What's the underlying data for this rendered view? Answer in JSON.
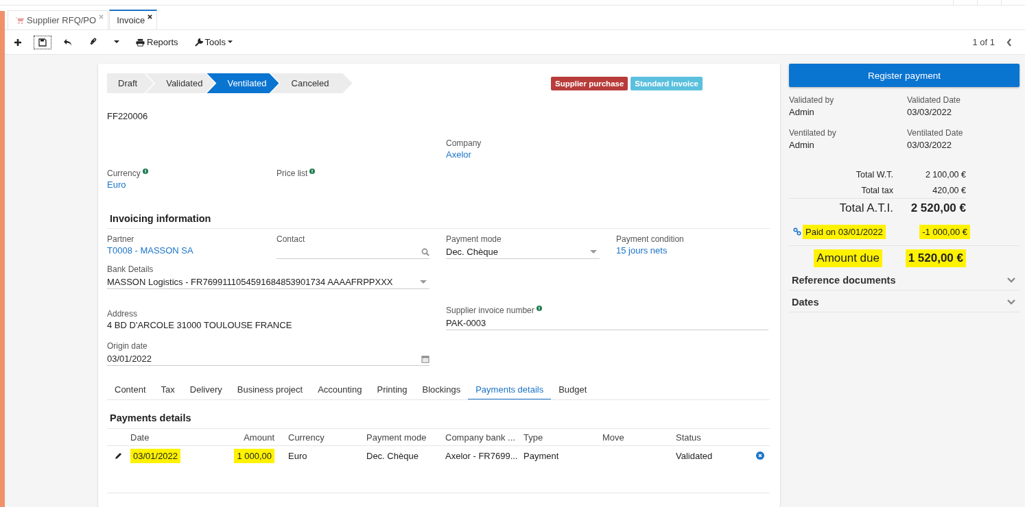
{
  "tabs": [
    {
      "label": "Supplier RFQ/PO",
      "selected": false
    },
    {
      "label": "Invoice",
      "selected": true
    }
  ],
  "toolbar": {
    "reports": "Reports",
    "tools": "Tools",
    "pager": "1 of 1"
  },
  "steps": [
    {
      "label": "Draft",
      "selected": false
    },
    {
      "label": "Validated",
      "selected": false
    },
    {
      "label": "Ventilated",
      "selected": true
    },
    {
      "label": "Canceled",
      "selected": false
    }
  ],
  "badges": [
    {
      "label": "Supplier purchase",
      "color": "#b83c3a"
    },
    {
      "label": "Standard invoice",
      "color": "#5bc0de"
    }
  ],
  "invoice_number": "FF220006",
  "fields": [
    {
      "label": "Company",
      "value": "Axelor",
      "kind": "link",
      "info": false
    },
    {
      "label": "Currency",
      "value": "Euro",
      "kind": "link",
      "info": true
    },
    {
      "label": "Price list",
      "kind": "text",
      "info": true
    }
  ],
  "invoicing_information": {
    "title": "Invoicing information",
    "fields": [
      {
        "label": "Partner",
        "value": "T0008 - MASSON SA",
        "kind": "link",
        "info": false
      },
      {
        "label": "Contact",
        "kind": "search",
        "info": false
      },
      {
        "label": "Payment mode",
        "value": "Dec. Chèque",
        "kind": "select",
        "info": false
      },
      {
        "label": "Payment condition",
        "value": "15 jours nets",
        "kind": "link",
        "info": false
      },
      {
        "label": "Bank Details",
        "value": "MASSON Logistics - FR7699111054591684853901734 AAAAFRPPXXX",
        "kind": "select",
        "info": false
      },
      {
        "label": "Address",
        "value": "4 BD D'ARCOLE 31000 TOULOUSE FRANCE",
        "kind": "text",
        "info": false
      },
      {
        "label": "Supplier invoice number",
        "value": "PAK-0003",
        "kind": "input",
        "info": true
      },
      {
        "label": "Origin date",
        "value": "03/01/2022",
        "kind": "date",
        "info": false
      }
    ]
  },
  "form_tabs": [
    {
      "label": "Content",
      "selected": false
    },
    {
      "label": "Tax",
      "selected": false
    },
    {
      "label": "Delivery",
      "selected": false
    },
    {
      "label": "Business project",
      "selected": false
    },
    {
      "label": "Accounting",
      "selected": false
    },
    {
      "label": "Printing",
      "selected": false
    },
    {
      "label": "Blockings",
      "selected": false
    },
    {
      "label": "Payments details",
      "selected": true
    },
    {
      "label": "Budget",
      "selected": false
    }
  ],
  "payments": {
    "title": "Payments details",
    "columns": [
      "Date",
      "Amount",
      "Currency",
      "Payment mode",
      "Company bank ...",
      "Type",
      "Move",
      "Status"
    ],
    "rows": [
      {
        "cells": [
          {
            "text": "03/01/2022",
            "highlighted": true
          },
          {
            "text": "1 000,00",
            "highlighted": true
          },
          {
            "text": "Euro",
            "highlighted": false
          },
          {
            "text": "Dec. Chèque",
            "highlighted": false
          },
          {
            "text": "Axelor - FR7699...",
            "highlighted": false
          },
          {
            "text": "Payment",
            "highlighted": false
          },
          null,
          {
            "text": "Validated",
            "highlighted": false
          }
        ]
      }
    ]
  },
  "side": {
    "button": "Register payment",
    "audit": [
      {
        "label": "Validated by",
        "value": "Admin"
      },
      {
        "label": "Validated Date",
        "value": "03/03/2022"
      },
      {
        "label": "Ventilated by",
        "value": "Admin"
      },
      {
        "label": "Ventilated Date",
        "value": "03/03/2022"
      }
    ],
    "totals": [
      {
        "label": "Total W.T.",
        "value": "2 100,00 €",
        "kind": "normal",
        "highlighted": false
      },
      {
        "label": "Total tax",
        "value": "420,00 €",
        "kind": "normal",
        "highlighted": false
      },
      {
        "label": "Total A.T.I.",
        "value": "2 520,00 €",
        "kind": "total",
        "highlighted": false
      },
      {
        "label": "Paid on 03/01/2022",
        "value": "-1 000,00 €",
        "kind": "payment",
        "highlighted": true
      },
      {
        "label": "Amount due",
        "value": "1 520,00 €",
        "kind": "due",
        "highlighted": true
      }
    ],
    "sections": [
      {
        "label": "Reference documents",
        "expanded": false
      },
      {
        "label": "Dates",
        "expanded": false
      }
    ]
  }
}
